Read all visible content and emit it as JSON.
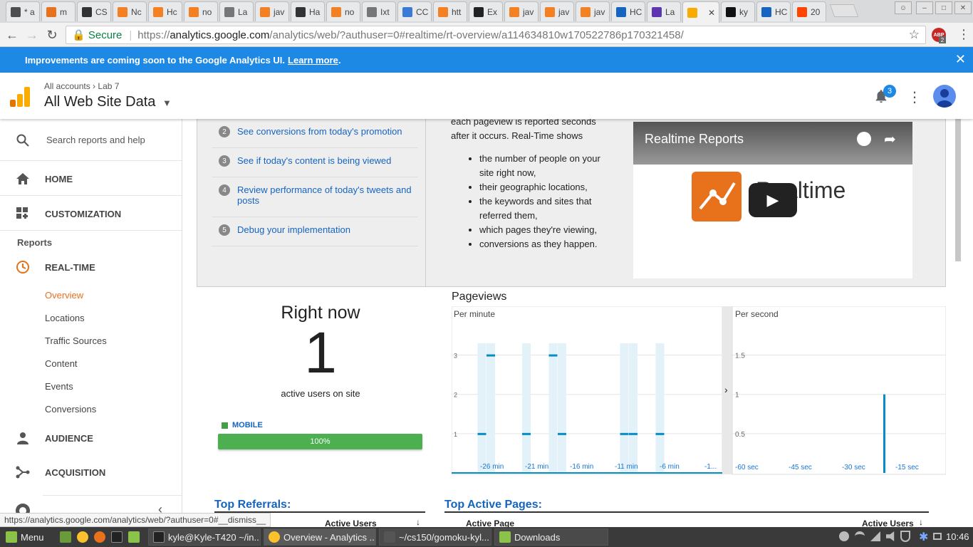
{
  "browser": {
    "tabs": [
      {
        "label": "* a",
        "color": "#4e4e4e"
      },
      {
        "label": "m",
        "color": "#e8711c"
      },
      {
        "label": "CS",
        "color": "#333333"
      },
      {
        "label": "Nc",
        "color": "#f48024"
      },
      {
        "label": "Hc",
        "color": "#f48024"
      },
      {
        "label": "no",
        "color": "#f48024"
      },
      {
        "label": "La",
        "color": "#777777"
      },
      {
        "label": "jav",
        "color": "#f48024"
      },
      {
        "label": "Ha",
        "color": "#333333"
      },
      {
        "label": "no",
        "color": "#f48024"
      },
      {
        "label": "Ixt",
        "color": "#777777"
      },
      {
        "label": "CC",
        "color": "#3a7bd5"
      },
      {
        "label": "htt",
        "color": "#f48024"
      },
      {
        "label": "Ex",
        "color": "#222222"
      },
      {
        "label": "jav",
        "color": "#f48024"
      },
      {
        "label": "jav",
        "color": "#f48024"
      },
      {
        "label": "jav",
        "color": "#f48024"
      },
      {
        "label": "HC",
        "color": "#1565c0"
      },
      {
        "label": "La",
        "color": "#5e35b1"
      },
      {
        "label": "",
        "color": "#f9ab00",
        "active": true
      },
      {
        "label": "ky",
        "color": "#111111"
      },
      {
        "label": "HC",
        "color": "#1565c0"
      },
      {
        "label": "20",
        "color": "#ff4500"
      }
    ],
    "secure_label": "Secure",
    "url_scheme": "https://",
    "url_host": "analytics.google.com",
    "url_path": "/analytics/web/?authuser=0#realtime/rt-overview/a114634810w170522786p170321458/",
    "abp_badge": "2"
  },
  "banner": {
    "text": "Improvements are coming soon to the Google Analytics UI.",
    "link": "Learn more",
    "suffix": ".",
    "close": "✕"
  },
  "header": {
    "crumb_accounts": "All accounts",
    "crumb_sep": "›",
    "crumb_property": "Lab 7",
    "property_title": "All Web Site Data",
    "notification_count": "3"
  },
  "sidebar": {
    "search_placeholder": "Search reports and help",
    "home": "HOME",
    "customization": "CUSTOMIZATION",
    "reports_heading": "Reports",
    "realtime": "REAL-TIME",
    "realtime_items": [
      "Overview",
      "Locations",
      "Traffic Sources",
      "Content",
      "Events",
      "Conversions"
    ],
    "audience": "AUDIENCE",
    "acquisition": "ACQUISITION"
  },
  "intro": {
    "steps": [
      {
        "num": "2",
        "text": "See conversions from today's promotion"
      },
      {
        "num": "3",
        "text": "See if today's content is being viewed"
      },
      {
        "num": "4",
        "text": "Review performance of today's tweets and posts"
      },
      {
        "num": "5",
        "text": "Debug your implementation"
      }
    ],
    "text_lead": "each pageview is reported seconds after it occurs. Real-Time shows",
    "bullets": [
      "the number of people on your site right now,",
      "their geographic locations,",
      "the keywords and sites that referred them,",
      "which pages they're viewing,",
      "conversions as they happen."
    ],
    "video_title": "Realtime Reports",
    "video_logo_text": "Realtime"
  },
  "rightnow": {
    "title": "Right now",
    "count": "1",
    "label": "active users on site",
    "device_label": "MOBILE",
    "device_percent": "100%",
    "device_fraction": 1.0,
    "device_color": "#4caf50"
  },
  "pageviews": {
    "title": "Pageviews",
    "per_minute_label": "Per minute",
    "per_second_label": "Per second",
    "expand_icon": "›"
  },
  "chart_data": [
    {
      "type": "bar",
      "title": "Per minute",
      "yticks": [
        1,
        2,
        3
      ],
      "ylim": [
        0,
        3.3
      ],
      "x_tick_labels": [
        "-26 min",
        "-21 min",
        "-16 min",
        "-11 min",
        "-6 min",
        "-1..."
      ],
      "minutes_ago": [
        29,
        28,
        27,
        26,
        25,
        24,
        23,
        22,
        21,
        20,
        19,
        18,
        17,
        16,
        15,
        14,
        13,
        12,
        11,
        10,
        9,
        8,
        7,
        6,
        5,
        4,
        3,
        2,
        1
      ],
      "values": [
        0,
        1,
        3,
        0,
        0,
        0,
        1,
        0,
        0,
        3,
        1,
        0,
        0,
        0,
        0,
        0,
        0,
        1,
        1,
        0,
        0,
        1,
        0,
        0,
        0,
        0,
        0,
        0,
        0
      ],
      "color": "#058dc7"
    },
    {
      "type": "bar",
      "title": "Per second",
      "yticks": [
        0.5,
        1,
        1.5
      ],
      "ylim": [
        0,
        1.65
      ],
      "x_tick_labels": [
        "-60 sec",
        "-45 sec",
        "-30 sec",
        "-15 sec"
      ],
      "spike_seconds_ago": 15,
      "spike_value": 1,
      "color": "#058dc7"
    }
  ],
  "tables": {
    "referrals_title": "Top Referrals:",
    "referrals_col": "Active Users",
    "pages_title": "Top Active Pages:",
    "pages_col1": "Active Page",
    "pages_col2": "Active Users"
  },
  "status_url": "https://analytics.google.com/analytics/web/?authuser=0#__dismiss__",
  "taskbar": {
    "menu": "Menu",
    "windows": [
      {
        "label": "kyle@Kyle-T420 ~/in...",
        "color": "#222222"
      },
      {
        "label": "Overview - Analytics ...",
        "color": "#f9ab00",
        "active": true
      },
      {
        "label": "~/cs150/gomoku-kyl...",
        "color": "#555555"
      },
      {
        "label": "Downloads",
        "color": "#8bc34a"
      }
    ],
    "time": "10:46"
  }
}
